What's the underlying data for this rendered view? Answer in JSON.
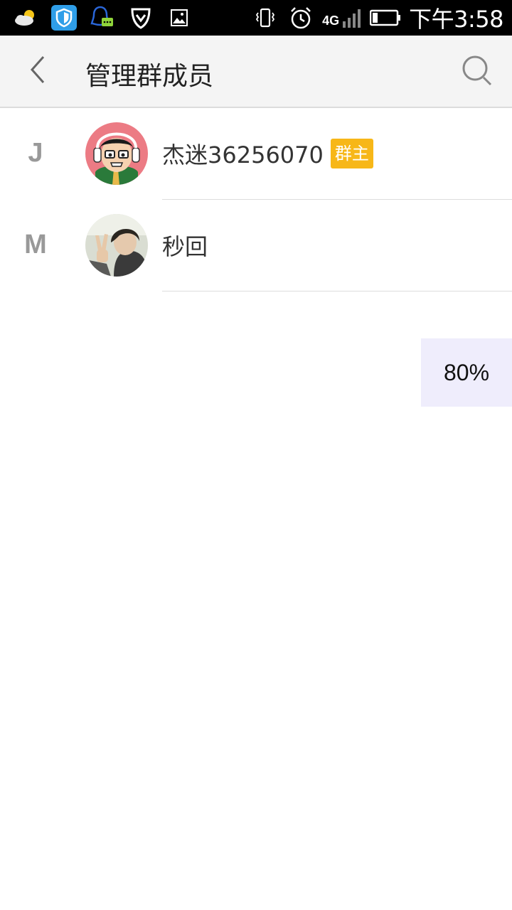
{
  "status_bar": {
    "time": "下午3:58",
    "network": "4G",
    "left_icons": [
      "weather-icon",
      "security-shield-icon",
      "qq-message-icon",
      "vpn-shield-icon",
      "gallery-icon"
    ],
    "right_icons": [
      "vibrate-icon",
      "alarm-icon",
      "signal-icon",
      "battery-icon"
    ]
  },
  "header": {
    "title": "管理群成员",
    "back_icon": "chevron-left-icon",
    "search_icon": "search-icon"
  },
  "members": [
    {
      "index": "J",
      "name": "杰迷36256070",
      "badge": "群主"
    },
    {
      "index": "M",
      "name": "秒回",
      "badge": ""
    }
  ],
  "zoom": {
    "label": "80%"
  },
  "colors": {
    "status_bar_bg": "#000000",
    "title_bar_bg": "#f4f4f4",
    "badge_bg": "#f7b718",
    "index_letter": "#999999",
    "zoom_bg": "#efedfc"
  }
}
